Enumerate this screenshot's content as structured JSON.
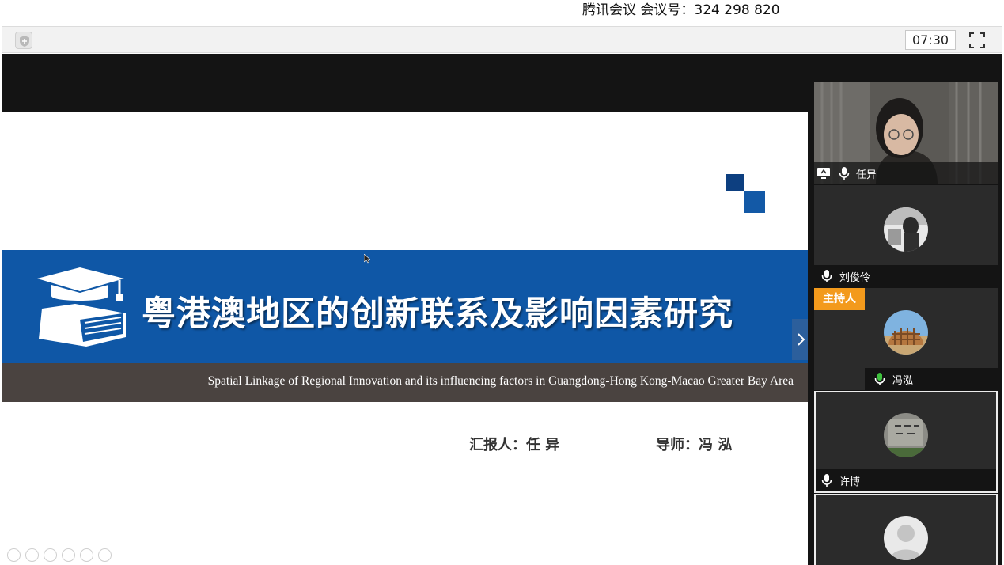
{
  "meeting": {
    "caption": "腾讯会议 会议号：324 298 820"
  },
  "toolbar": {
    "timer": "07:30"
  },
  "slide": {
    "title": "粤港澳地区的创新联系及影响因素研究",
    "subtitle": "Spatial Linkage of Regional Innovation and its influencing factors in Guangdong-Hong Kong-Macao Greater Bay Area",
    "presenter": "汇报人：任 异",
    "advisor": "导师：冯 泓"
  },
  "participants": [
    {
      "name": "任异",
      "video": true,
      "sharing": true
    },
    {
      "name": "刘俊伶"
    },
    {
      "name": "冯泓",
      "host_label": "主持人"
    },
    {
      "name": "许博"
    },
    {
      "name": ""
    }
  ],
  "colors": {
    "banner": "#0f57a6",
    "subbar": "#4a4340",
    "host_badge": "#f39a1c",
    "mic_active": "#3ec23e"
  }
}
